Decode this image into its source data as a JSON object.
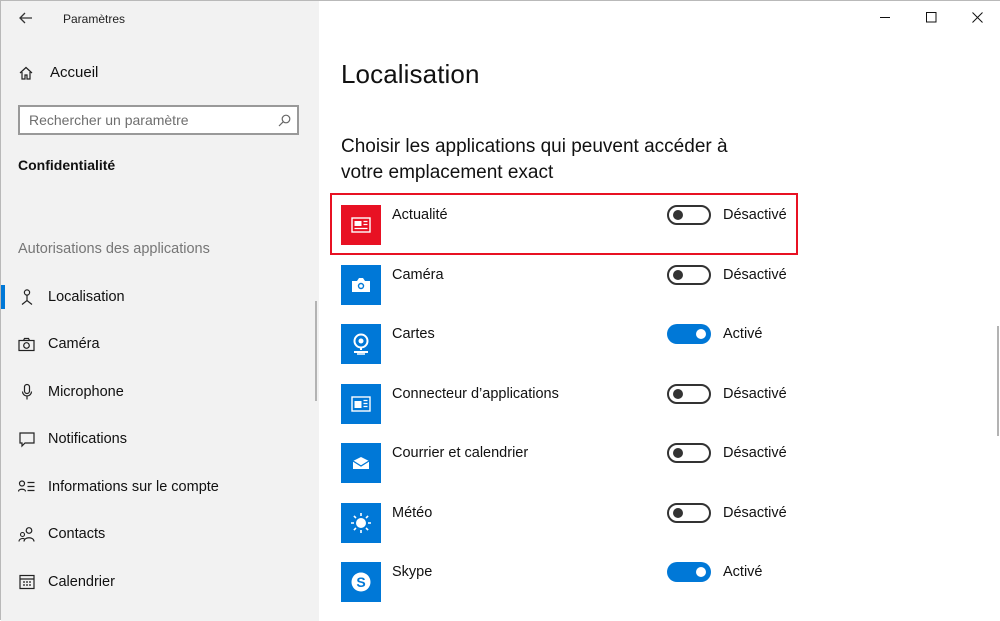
{
  "window": {
    "title": "Paramètres"
  },
  "sidebar": {
    "home_label": "Accueil",
    "search": {
      "placeholder": "Rechercher un paramètre"
    },
    "section_title": "Confidentialité",
    "group_title": "Autorisations des applications",
    "items": [
      {
        "label": "Localisation",
        "icon": "location-icon",
        "selected": true
      },
      {
        "label": "Caméra",
        "icon": "camera-icon",
        "selected": false
      },
      {
        "label": "Microphone",
        "icon": "microphone-icon",
        "selected": false
      },
      {
        "label": "Notifications",
        "icon": "notifications-icon",
        "selected": false
      },
      {
        "label": "Informations sur le compte",
        "icon": "account-info-icon",
        "selected": false
      },
      {
        "label": "Contacts",
        "icon": "contacts-icon",
        "selected": false
      },
      {
        "label": "Calendrier",
        "icon": "calendar-icon",
        "selected": false
      }
    ]
  },
  "main": {
    "page_title": "Localisation",
    "subtitle": "Choisir les applications qui peuvent accéder à votre emplacement exact",
    "apps": [
      {
        "name": "Actualité",
        "state_label": "Désactivé",
        "on": false,
        "icon": "news-icon",
        "tile_color": "#e81123",
        "highlighted": true
      },
      {
        "name": "Caméra",
        "state_label": "Désactivé",
        "on": false,
        "icon": "camera-app-icon",
        "tile_color": "#0078d7"
      },
      {
        "name": "Cartes",
        "state_label": "Activé",
        "on": true,
        "icon": "maps-icon",
        "tile_color": "#0078d7"
      },
      {
        "name": "Connecteur d’applications",
        "state_label": "Désactivé",
        "on": false,
        "icon": "app-connector-icon",
        "tile_color": "#0078d7"
      },
      {
        "name": "Courrier et calendrier",
        "state_label": "Désactivé",
        "on": false,
        "icon": "mail-icon",
        "tile_color": "#0078d7"
      },
      {
        "name": "Météo",
        "state_label": "Désactivé",
        "on": false,
        "icon": "weather-icon",
        "tile_color": "#0078d7"
      },
      {
        "name": "Skype",
        "state_label": "Activé",
        "on": true,
        "icon": "skype-icon",
        "tile_color": "#0078d7"
      }
    ]
  },
  "colors": {
    "accent": "#0078d7",
    "highlight_border": "#e81123",
    "sidebar_bg": "#f2f2f2"
  }
}
